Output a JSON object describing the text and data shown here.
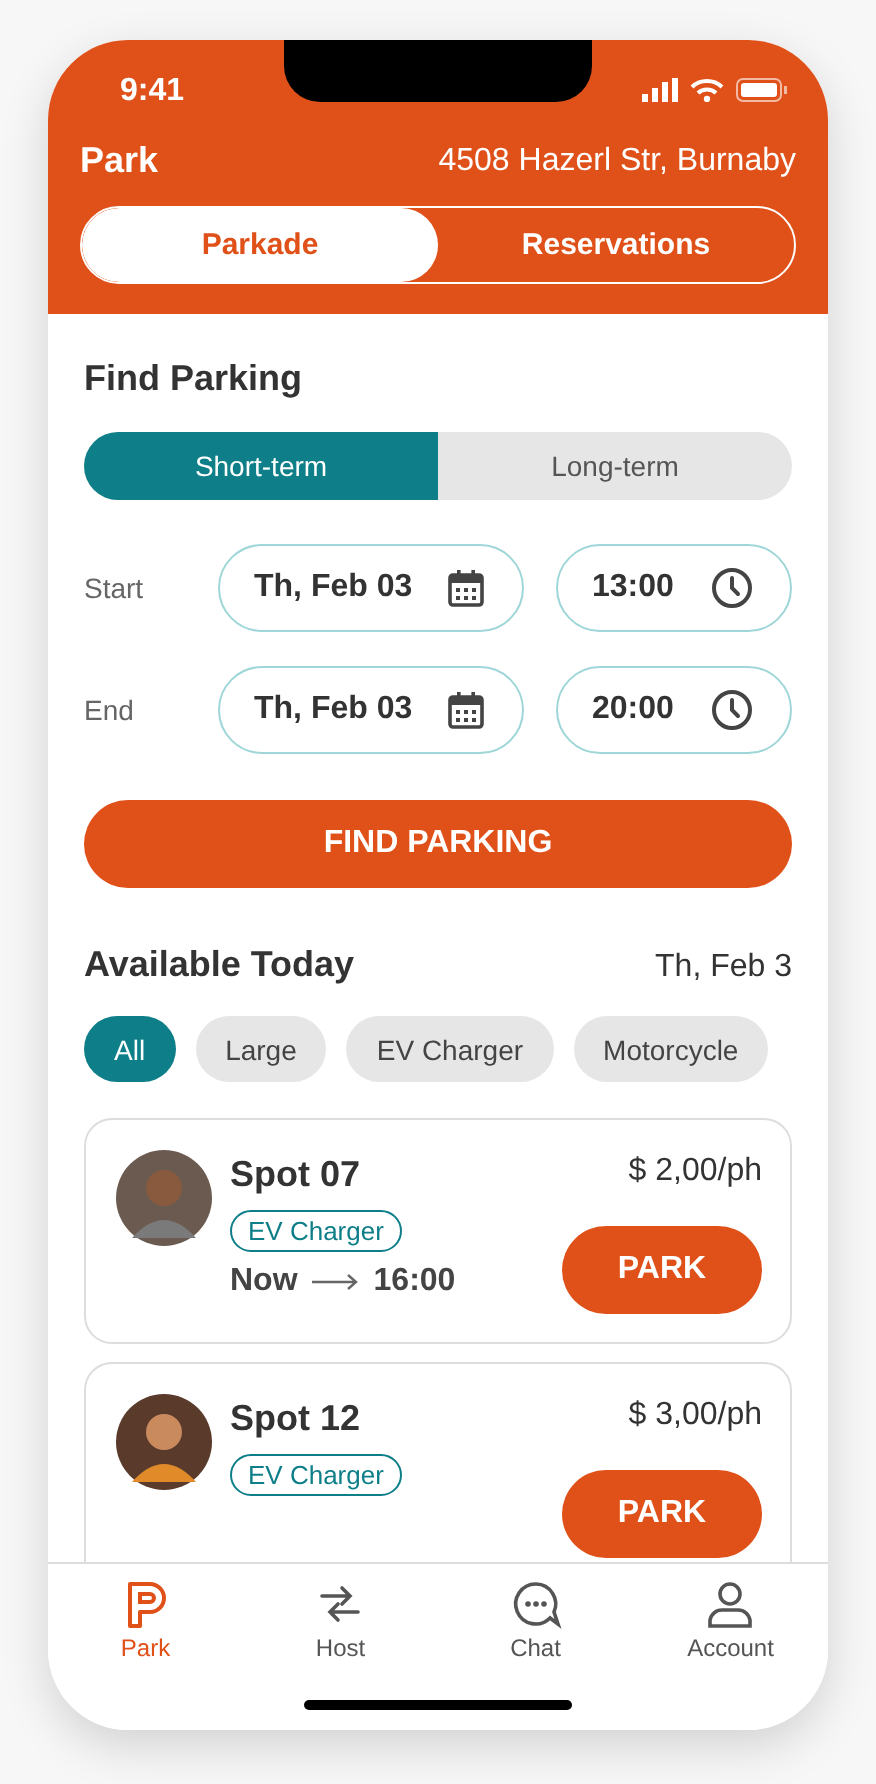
{
  "status_bar": {
    "time": "9:41"
  },
  "header": {
    "title": "Park",
    "address": "4508 Hazerl Str, Burnaby"
  },
  "segments": [
    {
      "label": "Parkade",
      "selected": true
    },
    {
      "label": "Reservations",
      "selected": false
    }
  ],
  "find_parking": {
    "title": "Find Parking",
    "terms": [
      {
        "label": "Short-term",
        "selected": true
      },
      {
        "label": "Long-term",
        "selected": false
      }
    ],
    "rows": [
      {
        "label": "Start",
        "date": "Th, Feb 03",
        "time": "13:00"
      },
      {
        "label": "End",
        "date": "Th, Feb 03",
        "time": "20:00"
      }
    ],
    "button": "FIND PARKING"
  },
  "available": {
    "title": "Available Today",
    "date": "Th, Feb 3",
    "filters": [
      {
        "label": "All",
        "selected": true
      },
      {
        "label": "Large",
        "selected": false
      },
      {
        "label": "EV Charger",
        "selected": false
      },
      {
        "label": "Motorcycle",
        "selected": false
      }
    ]
  },
  "spots": [
    {
      "name": "Spot 07",
      "tag": "EV Charger",
      "from": "Now",
      "to": "16:00",
      "price": "$ 2,00/ph",
      "button": "PARK"
    },
    {
      "name": "Spot 12",
      "tag": "EV Charger",
      "price": "$ 3,00/ph",
      "button": "PARK"
    }
  ],
  "tab_bar": [
    {
      "label": "Park",
      "selected": true
    },
    {
      "label": "Host",
      "selected": false
    },
    {
      "label": "Chat",
      "selected": false
    },
    {
      "label": "Account",
      "selected": false
    }
  ]
}
